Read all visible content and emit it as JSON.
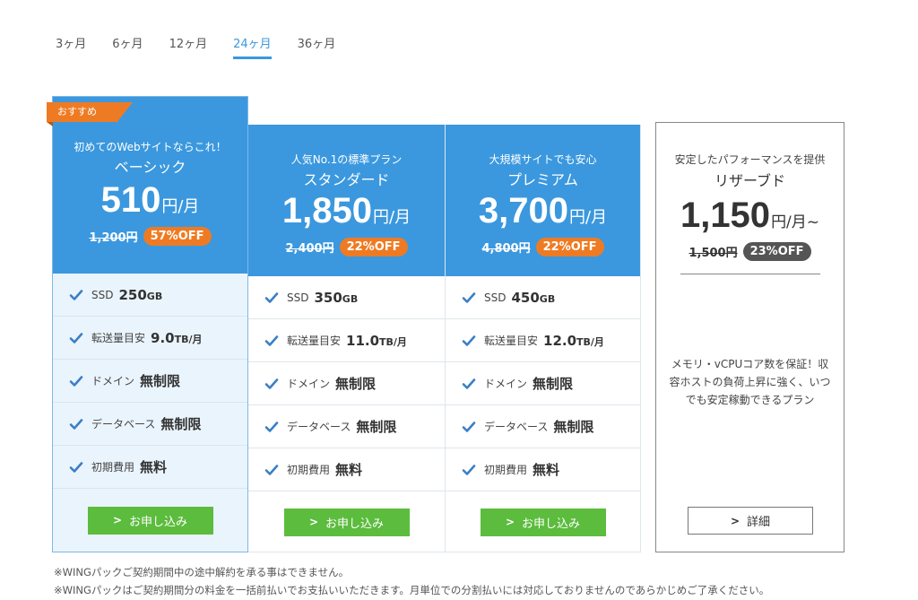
{
  "tabs": [
    {
      "label": "3ヶ月",
      "active": false
    },
    {
      "label": "6ヶ月",
      "active": false
    },
    {
      "label": "12ヶ月",
      "active": false
    },
    {
      "label": "24ヶ月",
      "active": true
    },
    {
      "label": "36ヶ月",
      "active": false
    }
  ],
  "plans": {
    "basic": {
      "badge": "おすすめ",
      "tagline": "初めてのWebサイトならこれ！",
      "name": "ベーシック",
      "price": "510",
      "unit": "円/月",
      "original": "1,200円",
      "discount": "57%OFF",
      "features": [
        {
          "label": "SSD",
          "value": "250",
          "suffix": "GB"
        },
        {
          "label": "転送量目安",
          "value": "9.0",
          "suffix": "TB/月"
        },
        {
          "label": "ドメイン",
          "value": "無制限",
          "suffix": ""
        },
        {
          "label": "データベース",
          "value": "無制限",
          "suffix": ""
        },
        {
          "label": "初期費用",
          "value": "無料",
          "suffix": ""
        }
      ],
      "button": "お申し込み"
    },
    "standard": {
      "tagline": "人気No.1の標準プラン",
      "name": "スタンダード",
      "price": "1,850",
      "unit": "円/月",
      "original": "2,400円",
      "discount": "22%OFF",
      "features": [
        {
          "label": "SSD",
          "value": "350",
          "suffix": "GB"
        },
        {
          "label": "転送量目安",
          "value": "11.0",
          "suffix": "TB/月"
        },
        {
          "label": "ドメイン",
          "value": "無制限",
          "suffix": ""
        },
        {
          "label": "データベース",
          "value": "無制限",
          "suffix": ""
        },
        {
          "label": "初期費用",
          "value": "無料",
          "suffix": ""
        }
      ],
      "button": "お申し込み"
    },
    "premium": {
      "tagline": "大規模サイトでも安心",
      "name": "プレミアム",
      "price": "3,700",
      "unit": "円/月",
      "original": "4,800円",
      "discount": "22%OFF",
      "features": [
        {
          "label": "SSD",
          "value": "450",
          "suffix": "GB"
        },
        {
          "label": "転送量目安",
          "value": "12.0",
          "suffix": "TB/月"
        },
        {
          "label": "ドメイン",
          "value": "無制限",
          "suffix": ""
        },
        {
          "label": "データベース",
          "value": "無制限",
          "suffix": ""
        },
        {
          "label": "初期費用",
          "value": "無料",
          "suffix": ""
        }
      ],
      "button": "お申し込み"
    },
    "reserve": {
      "tagline": "安定したパフォーマンスを提供",
      "name": "リザーブド",
      "price": "1,150",
      "unit": "円/月~",
      "original": "1,500円",
      "discount": "23%OFF",
      "description": "メモリ・vCPUコア数を保証！収容ホストの負荷上昇に強く、いつでも安定稼動できるプラン",
      "button": "詳細"
    }
  },
  "notes": [
    "※WINGパックご契約期間中の途中解約を承る事はできません。",
    "※WINGパックはご契約期間分の料金を一括前払いでお支払いいただきます。月単位での分割払いには対応しておりませんのであらかじめご了承ください。"
  ],
  "colors": {
    "accent": "#3b98de",
    "discount": "#ee7b23",
    "button": "#5cbc3d",
    "check": "#3b7fc4"
  },
  "icons": {
    "check": "check-icon",
    "chevron": "chevron-right-icon"
  }
}
